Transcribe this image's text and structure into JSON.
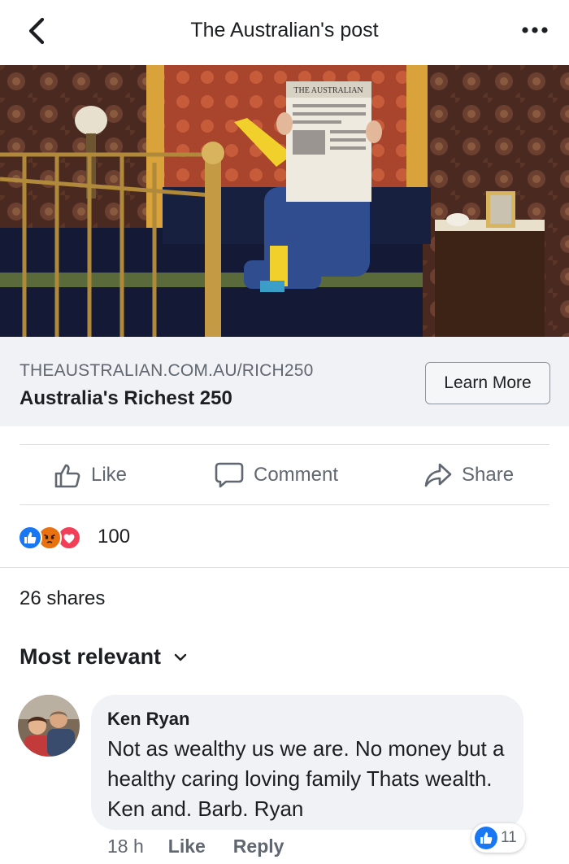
{
  "header": {
    "title": "The Australian's post",
    "back_icon": "chevron-left-icon",
    "more_icon": "more-dots-icon"
  },
  "hero": {
    "newspaper_masthead": "THE AUSTRALIAN"
  },
  "link_preview": {
    "domain": "THEAUSTRALIAN.COM.AU/RICH250",
    "title": "Australia's Richest 250",
    "cta_label": "Learn More"
  },
  "actions": {
    "like_label": "Like",
    "comment_label": "Comment",
    "share_label": "Share"
  },
  "reactions": {
    "count": "100",
    "types": [
      "like",
      "angry",
      "love"
    ],
    "colors": {
      "like": "#1877f2",
      "angry": "#e9710f",
      "love": "#f33e58"
    }
  },
  "shares": {
    "text": "26 shares"
  },
  "comments": {
    "sort_label": "Most relevant",
    "items": [
      {
        "author": "Ken Ryan",
        "text": "Not as wealthy us we are. No money but a healthy caring loving family Thats wealth.  Ken and. Barb. Ryan",
        "time": "18 h",
        "like_label": "Like",
        "reply_label": "Reply",
        "like_count": "11"
      }
    ]
  }
}
